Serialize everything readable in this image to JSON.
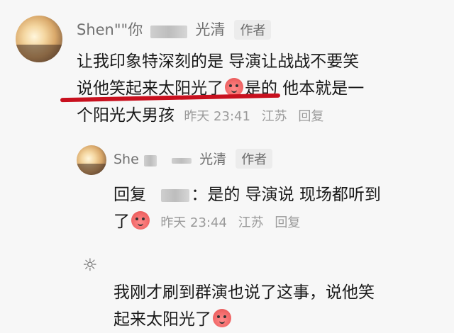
{
  "comment": {
    "author_visible": "Shen\"\"你",
    "author_suffix": "光清",
    "author_badge": "作者",
    "text_line1": "让我印象特深刻的是 导演让战战不要笑",
    "text_line2_a": "说他笑起来太阳光了",
    "text_line2_b": "是的 他本就是一",
    "text_line3": "个阳光大男孩",
    "time": "昨天 23:41",
    "location": "江苏",
    "reply_label": "回复"
  },
  "reply": {
    "author_visible": "She",
    "author_suffix": "光清",
    "author_badge": "作者",
    "reply_prefix": "回复",
    "text_after_name": "：是的 导演说 现场都听到",
    "text_line2": "了",
    "time": "昨天 23:44",
    "location": "江苏",
    "reply_label": "回复"
  },
  "comment3": {
    "text_line1": "我刚才刷到群演也说了这事，说他笑",
    "text_line2": "起来太阳光了"
  },
  "icons": {
    "emoji": "blush-emoji-icon",
    "avatar3": "sun-icon"
  },
  "colors": {
    "underline": "#c8101e",
    "meta": "#9a9a9a",
    "name": "#707070"
  }
}
